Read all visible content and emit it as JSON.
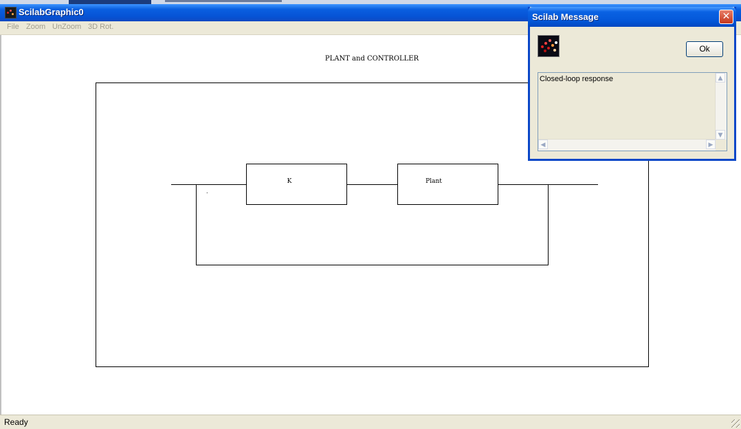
{
  "window": {
    "title": "ScilabGraphic0",
    "menu": [
      "File",
      "Zoom",
      "UnZoom",
      "3D Rot."
    ],
    "status": "Ready"
  },
  "diagram": {
    "title": "PLANT  and  CONTROLLER",
    "blocks": [
      "K",
      "Plant"
    ],
    "sum_label": "."
  },
  "dialog": {
    "title": "Scilab Message",
    "ok_label": "Ok",
    "message": "Closed-loop response",
    "icon": "scilab-icon",
    "close_icon": "close-icon"
  }
}
